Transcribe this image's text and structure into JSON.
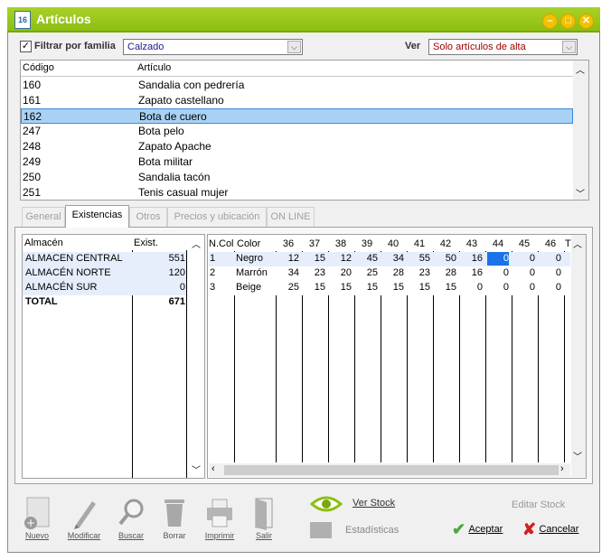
{
  "window": {
    "title": "Artículos",
    "icon_text": "16"
  },
  "filter": {
    "checkbox_label": "Filtrar por familia",
    "checked": true,
    "family_value": "Calzado",
    "ver_label": "Ver",
    "ver_value": "Solo artículos de alta"
  },
  "articles": {
    "headers": [
      "Código",
      "Artículo"
    ],
    "rows": [
      [
        "160",
        "Sandalia con pedrería"
      ],
      [
        "161",
        "Zapato castellano"
      ],
      [
        "162",
        "Bota de cuero"
      ],
      [
        "247",
        "Bota pelo"
      ],
      [
        "248",
        "Zapato Apache"
      ],
      [
        "249",
        "Bota militar"
      ],
      [
        "250",
        "Sandalia tacón"
      ],
      [
        "251",
        "Tenis casual mujer"
      ]
    ],
    "selected_index": 2
  },
  "tabs": [
    "General",
    "Existencias",
    "Otros",
    "Precios y ubicación",
    "ON LINE"
  ],
  "active_tab": 1,
  "stock": {
    "headers": [
      "Almacén",
      "Exist."
    ],
    "rows": [
      [
        "ALMACEN CENTRAL",
        "551"
      ],
      [
        "ALMACÉN NORTE",
        "120"
      ],
      [
        "ALMACÉN SUR",
        "0"
      ]
    ],
    "total_label": "TOTAL",
    "total_value": "671"
  },
  "sizes": {
    "headers": [
      "N.Col",
      "Color",
      "36",
      "37",
      "38",
      "39",
      "40",
      "41",
      "42",
      "43",
      "44",
      "45",
      "46",
      "T"
    ],
    "rows": [
      [
        "1",
        "Negro",
        "12",
        "15",
        "12",
        "45",
        "34",
        "55",
        "50",
        "16",
        "0",
        "0",
        "0"
      ],
      [
        "2",
        "Marrón",
        "34",
        "23",
        "20",
        "25",
        "28",
        "23",
        "28",
        "16",
        "0",
        "0",
        "0"
      ],
      [
        "3",
        "Beige",
        "25",
        "15",
        "15",
        "15",
        "15",
        "15",
        "15",
        "0",
        "0",
        "0",
        "0"
      ]
    ]
  },
  "toolbar": {
    "nuevo": "Nuevo",
    "modificar": "Modificar",
    "buscar": "Buscar",
    "borrar": "Borrar",
    "imprimir": "Imprimir",
    "salir": "Salir",
    "ver_stock": "Ver Stock",
    "estadisticas": "Estadísticas",
    "editar_stock": "Editar Stock",
    "aceptar": "Aceptar",
    "cancelar": "Cancelar"
  },
  "colors": {
    "titlebar": "#9acb1e",
    "selection": "#a9d1f3",
    "cell_selection": "#1a73e8"
  }
}
